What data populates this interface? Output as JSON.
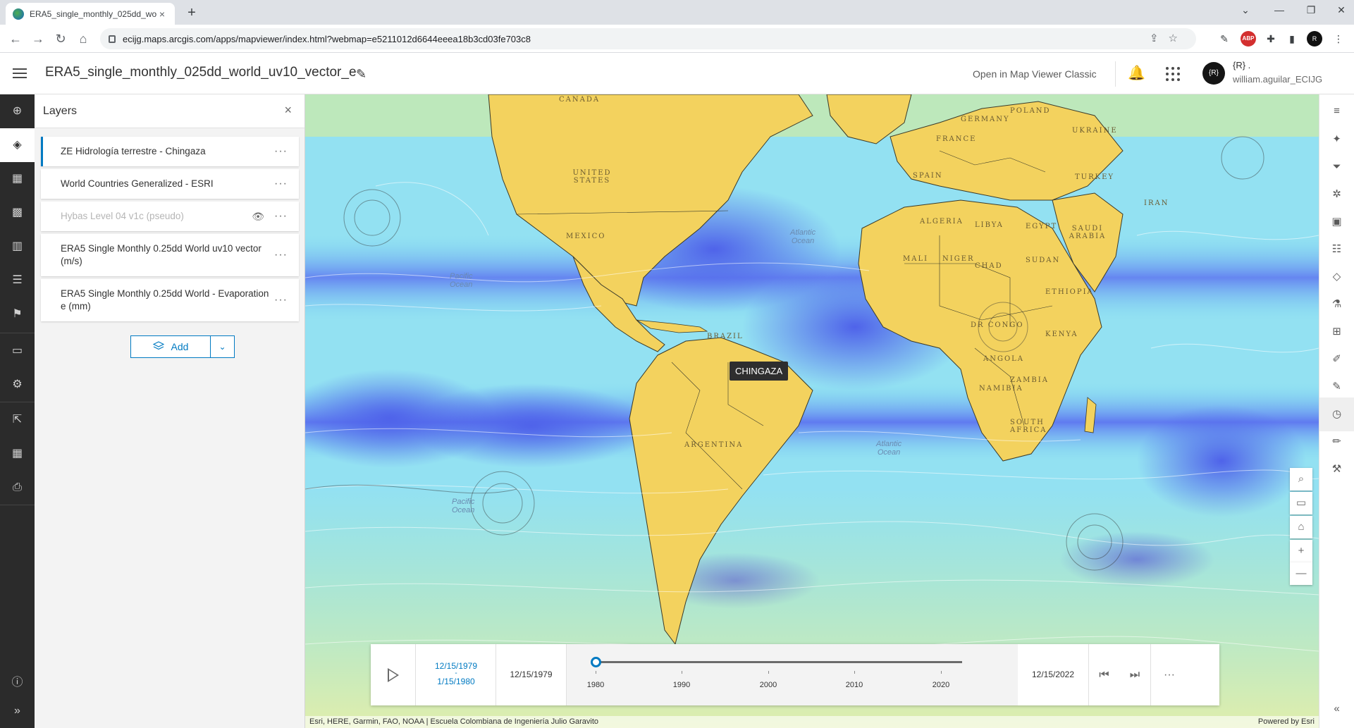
{
  "browser": {
    "tab_title": "ERA5_single_monthly_025dd_wo",
    "tab_close": "×",
    "new_tab": "+",
    "url": "ecijg.maps.arcgis.com/apps/mapviewer/index.html?webmap=e5211012d6644eeea18b3cd03fe703c8",
    "window_controls": [
      "⌄",
      "—",
      "❐",
      "✕"
    ],
    "nav": {
      "back": "←",
      "forward": "→",
      "reload": "↻",
      "home": "⌂"
    },
    "omni_icons": "⇪☆",
    "extensions": [
      "✎",
      "ABP",
      "✚",
      "▮",
      "R",
      "⋮"
    ]
  },
  "header": {
    "title": "ERA5_single_monthly_025dd_world_uv10_vector_e",
    "edit_icon": "✎",
    "open_classic": "Open in Map Viewer Classic",
    "notifications_icon": "🔔",
    "avatar_text": "{R}",
    "user_org": "{R} .",
    "user_name": "william.aguilar_ECIJG"
  },
  "left_bar": {
    "items": [
      {
        "name": "add-icon",
        "glyph": "⊕"
      },
      {
        "name": "layers-icon",
        "glyph": "◈"
      },
      {
        "name": "tables-icon",
        "glyph": "▦"
      },
      {
        "name": "basemap-icon",
        "glyph": "▩"
      },
      {
        "name": "charts-icon",
        "glyph": "▥"
      },
      {
        "name": "legend-icon",
        "glyph": "☰"
      },
      {
        "name": "bookmarks-icon",
        "glyph": "⚑"
      },
      {
        "name": "properties-icon",
        "glyph": "▭"
      },
      {
        "name": "settings-icon",
        "glyph": "⚙"
      },
      {
        "name": "share-icon",
        "glyph": "⇱"
      },
      {
        "name": "apps-icon",
        "glyph": "▦"
      },
      {
        "name": "print-icon",
        "glyph": "⎙"
      }
    ],
    "info_icon": "ⓘ",
    "expand_icon": "»"
  },
  "layers_panel": {
    "title": "Layers",
    "close_icon": "×",
    "more_icon": "···",
    "eye_icon": "👁",
    "layers": [
      {
        "name": "ZE Hidrología terrestre - Chingaza",
        "selected": true,
        "dim": false
      },
      {
        "name": "World Countries Generalized - ESRI",
        "selected": false,
        "dim": false
      },
      {
        "name": "Hybas Level 04 v1c (pseudo)",
        "selected": false,
        "dim": true
      },
      {
        "name": "ERA5 Single Monthly 0.25dd World uv10 vector (m/s)",
        "selected": false,
        "dim": false
      },
      {
        "name": "ERA5 Single Monthly 0.25dd World - Evaporation e (mm)",
        "selected": false,
        "dim": false
      }
    ],
    "add_label": "Add",
    "add_dropdown": "⌄"
  },
  "map": {
    "tooltip": "CHINGAZA",
    "oceans": {
      "atlantic_n": [
        "Atlantic",
        "Ocean"
      ],
      "pacific_n": [
        "Pacific",
        "Ocean"
      ],
      "atlantic_s": [
        "Atlantic",
        "Ocean"
      ],
      "pacific_s": [
        "Pacific",
        "Ocean"
      ]
    },
    "countries": [
      "CANADA",
      "UNITED STATES",
      "MEXICO",
      "BRAZIL",
      "ARGENTINA",
      "ALGERIA",
      "LIBYA",
      "EGYPT",
      "MALI",
      "NIGER",
      "CHAD",
      "SUDAN",
      "ETHIOPIA",
      "DR CONGO",
      "ANGOLA",
      "NAMIBIA",
      "SOUTH AFRICA",
      "UKRAINE",
      "TURKEY",
      "IRAN",
      "SAUDI ARABIA",
      "SPAIN",
      "POLAND",
      "GERMANY",
      "FRANCE",
      "KENYA",
      "ZAMBIA"
    ],
    "attribution": "Esri, HERE, Garmin, FAO, NOAA | Escuela Colombiana de Ingeniería Julio Garavito",
    "powered_by": "Powered by Esri",
    "widgets": {
      "search": "⌕",
      "screen": "▭",
      "home": "⌂",
      "zoom_in": "+",
      "zoom_out": "—"
    },
    "colors": {
      "land": "#f3d25e",
      "ocean_light": "#9fe6f0",
      "ocean_deep": "#5d74ec",
      "ocean_mid": "#7fc6f3",
      "accent": "#007ac2"
    }
  },
  "time_slider": {
    "current_range_start": "12/15/1979",
    "current_range_sep": "-",
    "current_range_end": "1/15/1980",
    "min_date": "12/15/1979",
    "max_date": "12/15/2022",
    "position_fraction": 0.0,
    "ticks": [
      "1980",
      "1990",
      "2000",
      "2010",
      "2020"
    ],
    "prev_icon": "⏮",
    "next_icon": "⏭",
    "options_icon": "···"
  },
  "right_bar": {
    "items": [
      {
        "name": "properties-icon",
        "glyph": "≡"
      },
      {
        "name": "styles-icon",
        "glyph": "✦"
      },
      {
        "name": "filter-icon",
        "glyph": "⏷"
      },
      {
        "name": "effects-icon",
        "glyph": "✲"
      },
      {
        "name": "popups-icon",
        "glyph": "▣"
      },
      {
        "name": "fields-icon",
        "glyph": "☷"
      },
      {
        "name": "labels-icon",
        "glyph": "◇"
      },
      {
        "name": "configure-icon",
        "glyph": "⚗"
      },
      {
        "name": "analysis-icon",
        "glyph": "⊞"
      },
      {
        "name": "sketch-icon",
        "glyph": "✐"
      },
      {
        "name": "edit-icon",
        "glyph": "✎"
      },
      {
        "name": "time-icon",
        "glyph": "◷"
      },
      {
        "name": "measure-icon",
        "glyph": "✏"
      },
      {
        "name": "tools-icon",
        "glyph": "⚒"
      }
    ],
    "collapse_icon": "«"
  }
}
